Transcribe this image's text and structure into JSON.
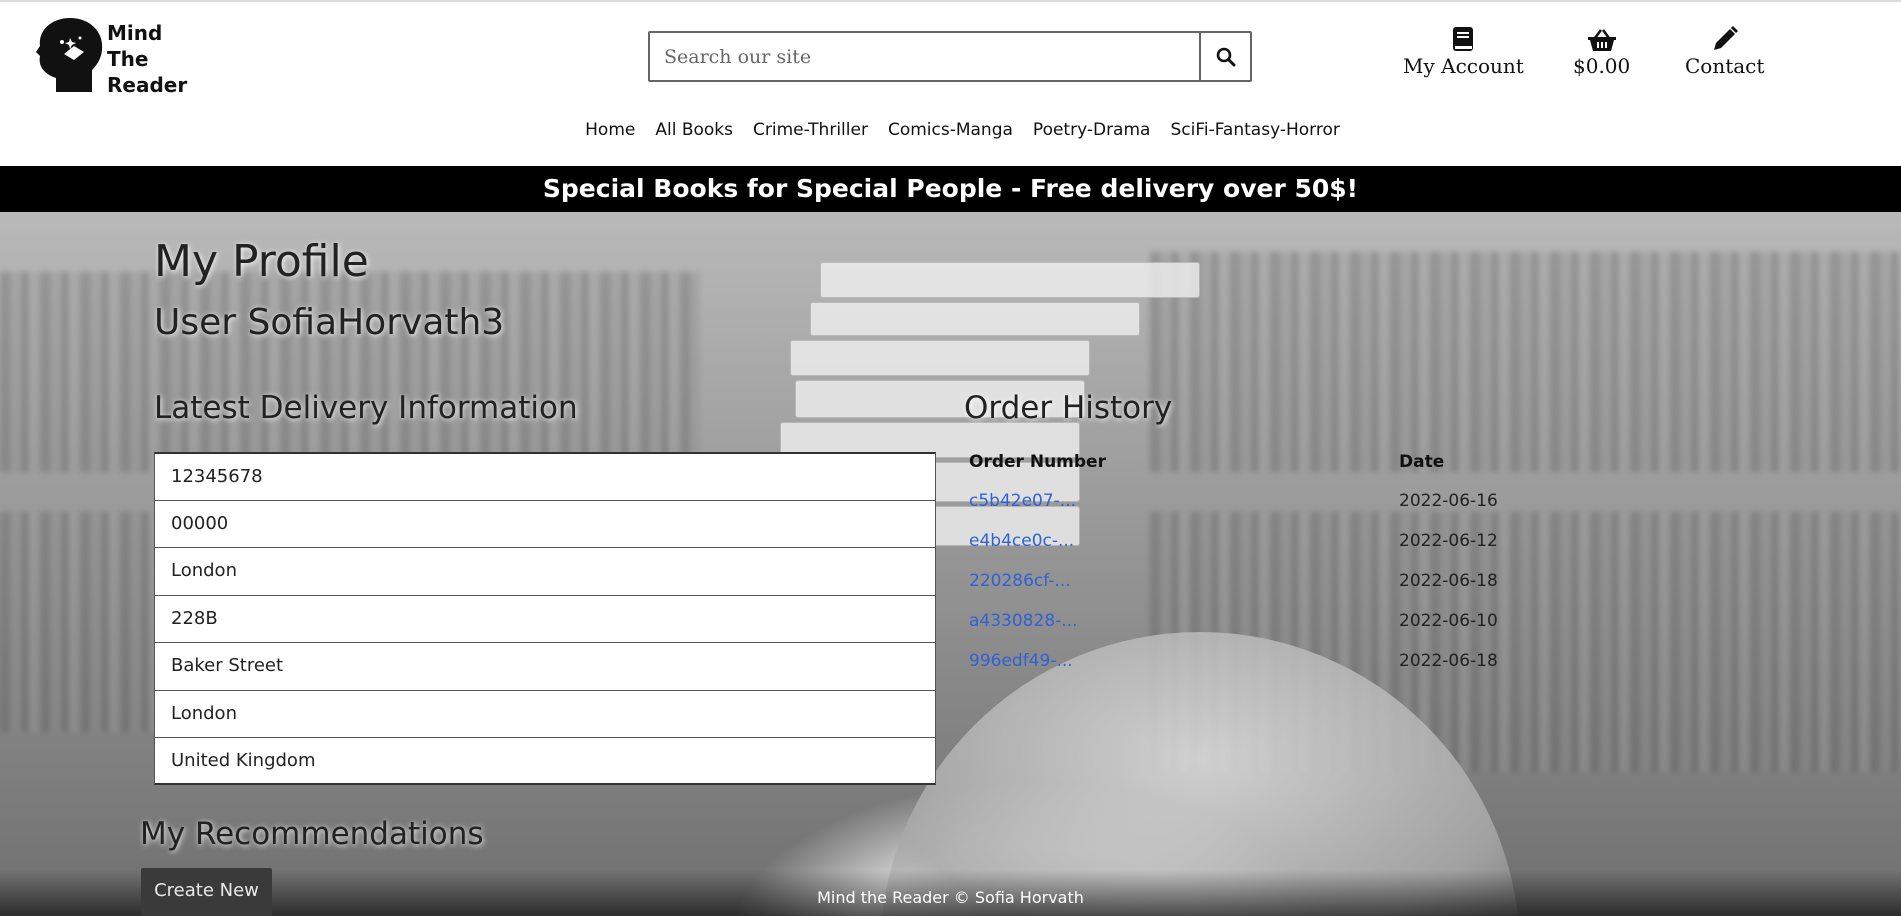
{
  "logo": {
    "line1": "Mind",
    "line2": "The",
    "line3": "Reader"
  },
  "search": {
    "placeholder": "Search our site"
  },
  "header": {
    "account_label": "My Account",
    "basket_label": "$0.00",
    "contact_label": "Contact"
  },
  "nav": [
    "Home",
    "All Books",
    "Crime-Thriller",
    "Comics-Manga",
    "Poetry-Drama",
    "SciFi-Fantasy-Horror"
  ],
  "promo": "Special Books for Special People - Free delivery over 50$!",
  "profile": {
    "title": "My Profile",
    "user": "User SofiaHorvath3"
  },
  "delivery": {
    "heading": "Latest Delivery Information",
    "fields": [
      "12345678",
      "00000",
      "London",
      "228B",
      "Baker Street",
      "London",
      "United Kingdom"
    ]
  },
  "orders": {
    "heading": "Order History",
    "col_number": "Order Number",
    "col_date": "Date",
    "rows": [
      {
        "number": "c5b42e07-...",
        "date": "2022-06-16"
      },
      {
        "number": "e4b4ce0c-...",
        "date": "2022-06-12"
      },
      {
        "number": "220286cf-...",
        "date": "2022-06-18"
      },
      {
        "number": "a4330828-...",
        "date": "2022-06-10"
      },
      {
        "number": "996edf49-...",
        "date": "2022-06-18"
      }
    ]
  },
  "recommendations": {
    "heading": "My Recommendations",
    "create_label": "Create New"
  },
  "footer": "Mind the Reader © Sofia Horvath",
  "icons": {
    "account": "book-icon",
    "basket": "basket-icon",
    "contact": "pencil-icon",
    "search": "search-icon"
  },
  "colors": {
    "link": "#2f62d6",
    "promo_bg": "#000000"
  }
}
